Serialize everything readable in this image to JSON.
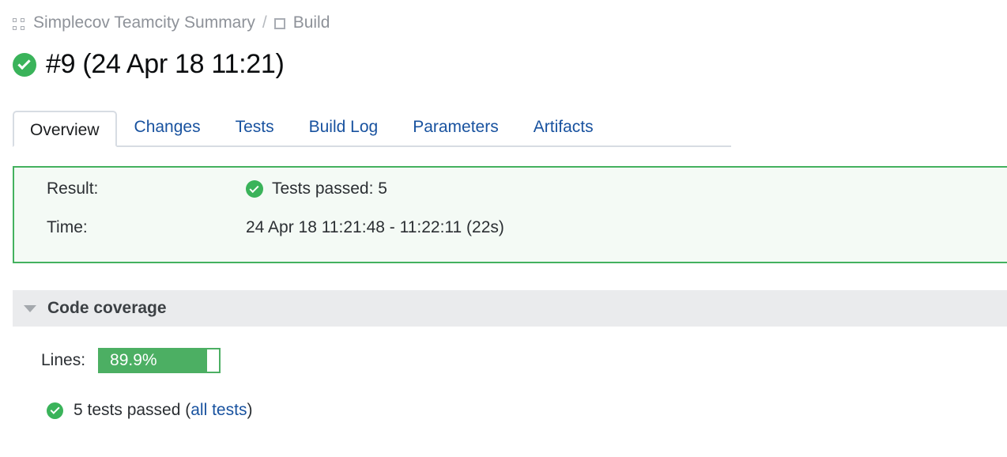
{
  "breadcrumb": {
    "project_icon": "grid-icon",
    "project": "Simplecov Teamcity Summary",
    "separator": "/",
    "build_icon": "square-icon",
    "build": "Build"
  },
  "header": {
    "status_icon": "success-check-icon",
    "title": "#9 (24 Apr 18 11:21)"
  },
  "tabs": [
    {
      "label": "Overview",
      "active": true
    },
    {
      "label": "Changes",
      "active": false
    },
    {
      "label": "Tests",
      "active": false
    },
    {
      "label": "Build Log",
      "active": false
    },
    {
      "label": "Parameters",
      "active": false
    },
    {
      "label": "Artifacts",
      "active": false
    }
  ],
  "result_panel": {
    "border_color": "#44b15f",
    "background_color": "#f4faf5",
    "result_label": "Result:",
    "result_icon": "success-check-icon",
    "result_value": "Tests passed: 5",
    "time_label": "Time:",
    "time_value": "24 Apr 18 11:21:48 - 11:22:11 (22s)"
  },
  "coverage_section": {
    "caret_icon": "chevron-down-icon",
    "title": "Code coverage",
    "metric_label": "Lines:",
    "metric_value": "89.9%",
    "metric_percent": 89.9,
    "bar_color": "#4caf63"
  },
  "tests_summary": {
    "icon": "success-check-icon",
    "text_before": "5 tests passed (",
    "link_label": "all tests",
    "text_after": ")"
  }
}
